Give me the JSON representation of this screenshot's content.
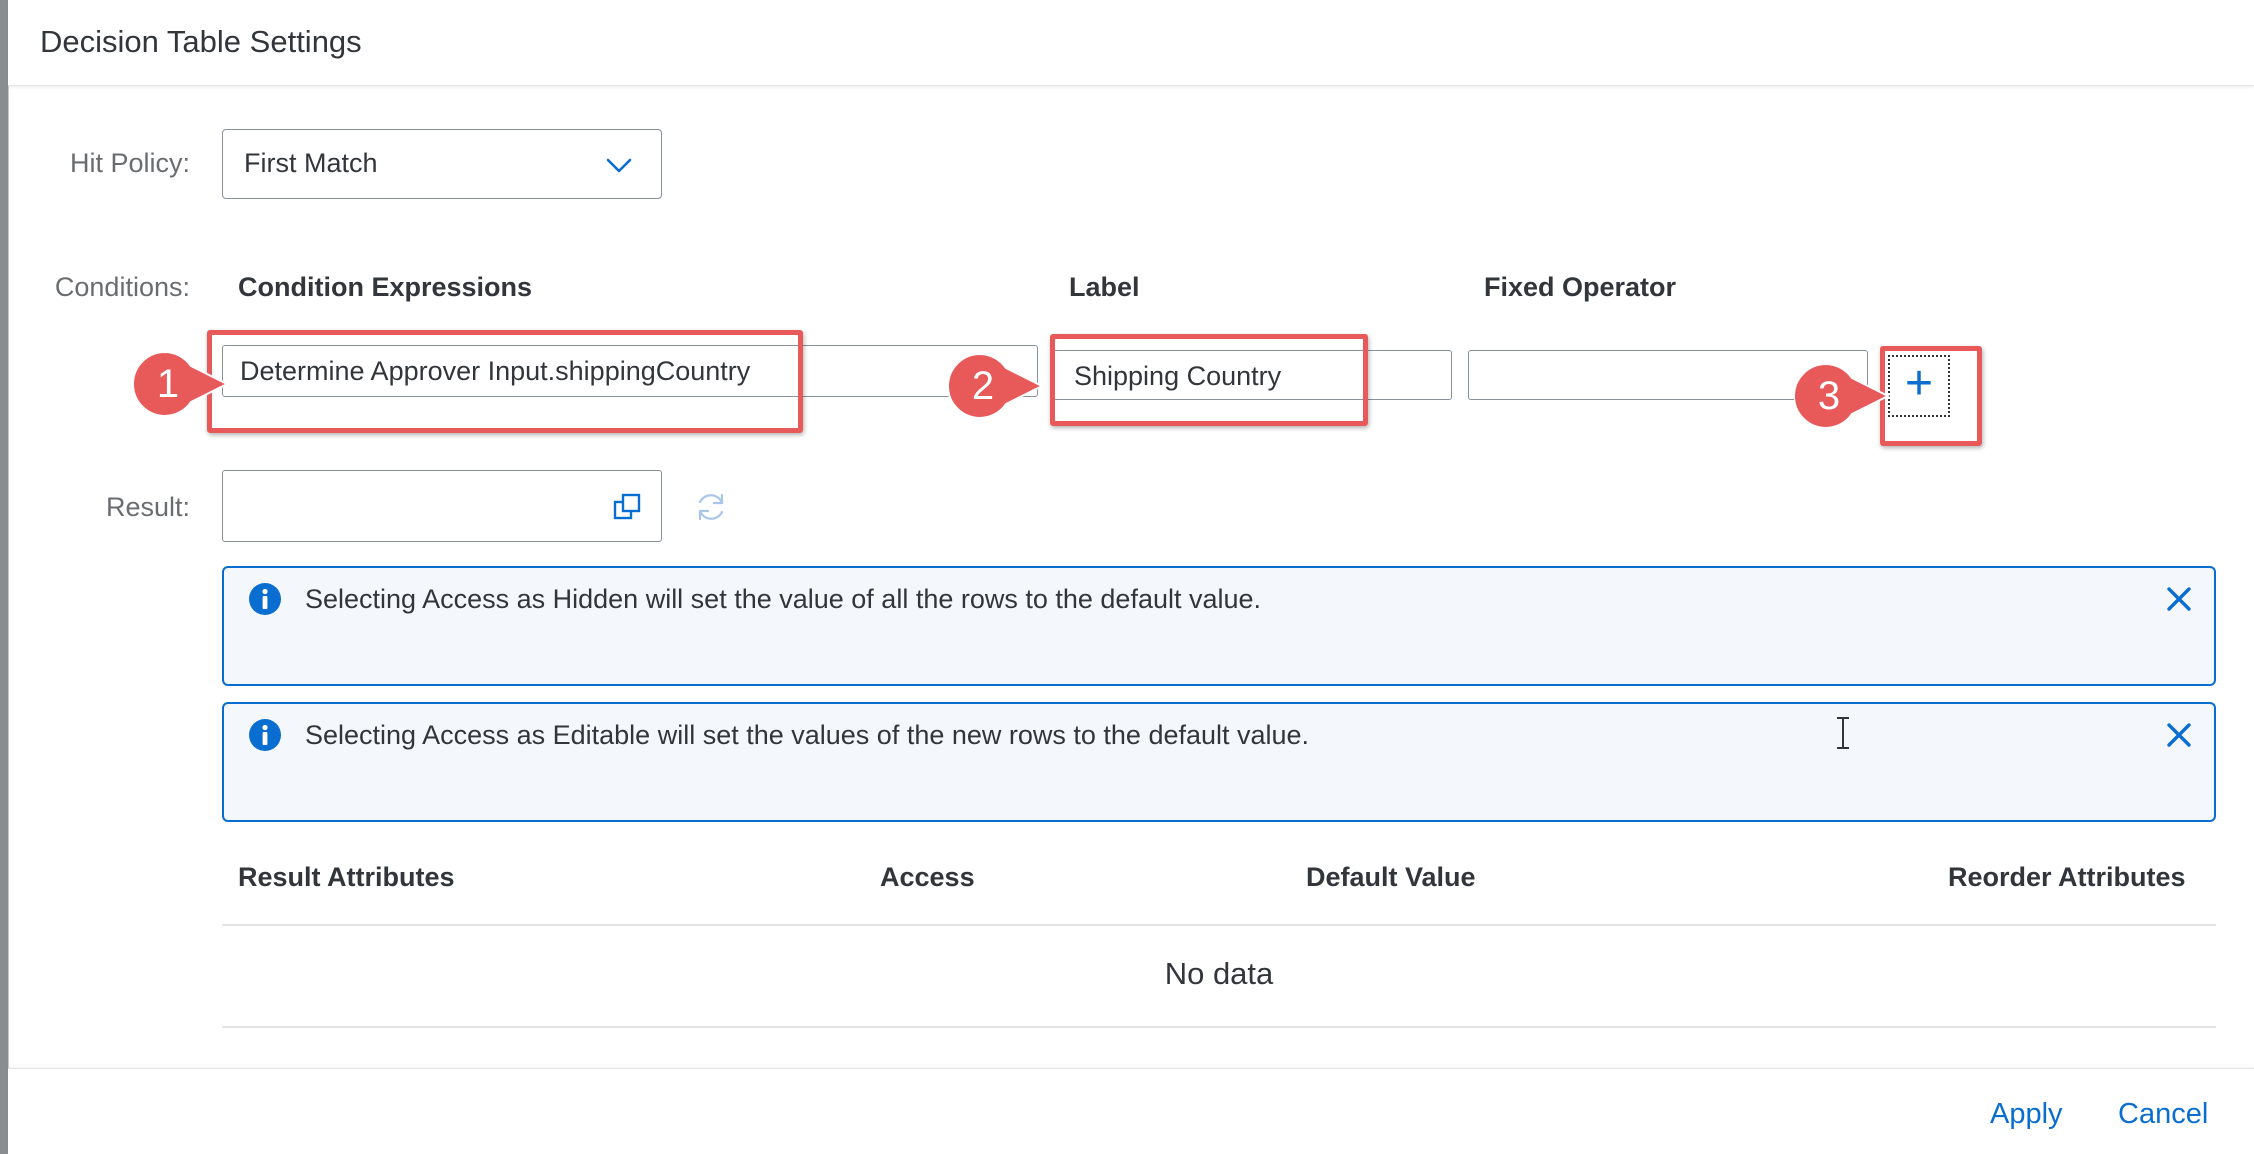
{
  "dialog": {
    "title": "Decision Table Settings"
  },
  "hit_policy": {
    "label": "Hit Policy:",
    "value": "First Match",
    "icon": "chevron-down-icon"
  },
  "conditions": {
    "label": "Conditions:",
    "headers": {
      "expressions": "Condition Expressions",
      "label": "Label",
      "fixed_operator": "Fixed Operator"
    },
    "row": {
      "expression": "Determine Approver Input.shippingCountry",
      "label": "Shipping Country",
      "fixed_operator": ""
    },
    "add_button": {
      "glyph": "+",
      "icon": "add-icon"
    }
  },
  "result": {
    "label": "Result:",
    "value": "",
    "icons": [
      "value-help-icon",
      "refresh-icon"
    ]
  },
  "messages": [
    {
      "text": "Selecting Access as Hidden will set the value of all the rows to the default value.",
      "icon": "info-icon"
    },
    {
      "text": "Selecting Access as Editable will set the values of the new rows to the default value.",
      "icon": "info-icon"
    }
  ],
  "result_table": {
    "headers": [
      "Result Attributes",
      "Access",
      "Default Value",
      "Reorder Attributes"
    ],
    "empty_text": "No data"
  },
  "callouts": [
    "1",
    "2",
    "3"
  ],
  "footer": {
    "apply": "Apply",
    "cancel": "Cancel"
  },
  "colors": {
    "accent": "#0a6ed1",
    "highlight": "#e8595a",
    "message_bg": "#f4f8fd",
    "text": "#32363a",
    "label": "#6a6d70"
  }
}
